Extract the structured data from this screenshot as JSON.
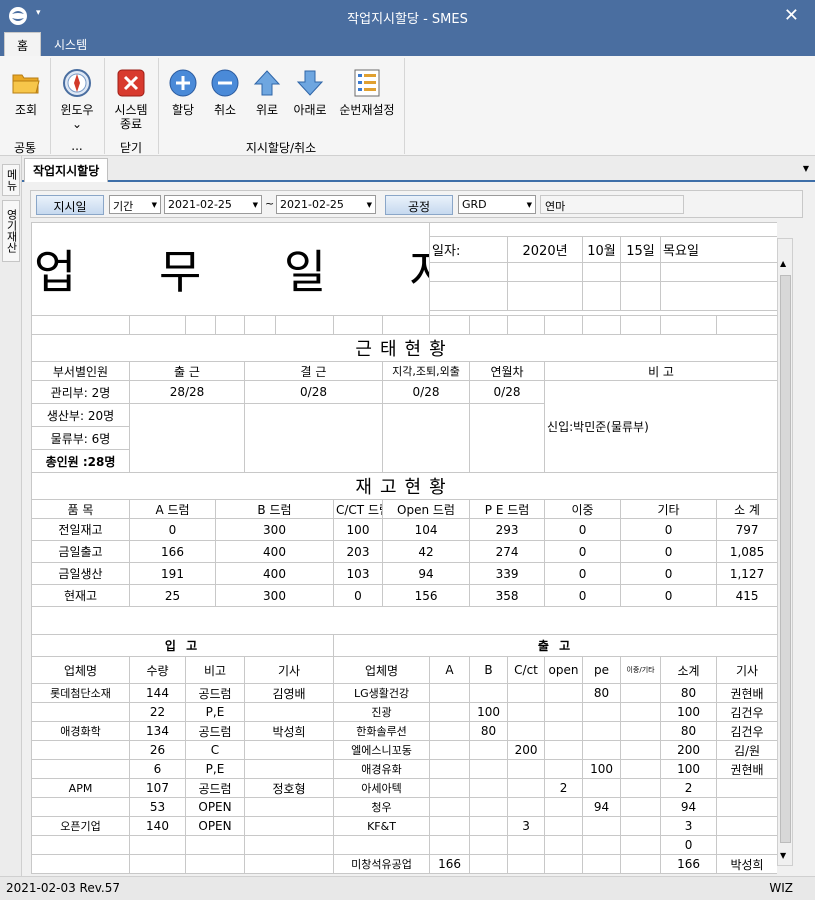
{
  "window": {
    "title": "작업지시할당 - SMES",
    "quick_access": "▾",
    "close": "✕"
  },
  "ribbon_tabs": [
    "홈",
    "시스템"
  ],
  "ribbon": {
    "buttons": [
      "조회",
      "윈도우",
      "시스템",
      "종료",
      "할당",
      "취소",
      "위로",
      "아래로",
      "순번재설정"
    ],
    "dropdown_mark": "⌄",
    "groups": [
      "공통",
      "...",
      "닫기",
      "지시할당/취소"
    ]
  },
  "side_tabs": [
    "메뉴",
    "영기재산"
  ],
  "doc_tab": "작업지시할당",
  "filter": {
    "btn_date": "지시일",
    "period": "기간",
    "date_from": "2021-02-25",
    "tilde": "~",
    "date_to": "2021-02-25",
    "btn_process": "공정",
    "process": "GRD",
    "process_name": "연마"
  },
  "report": {
    "title": "업 무 일 지",
    "date_label": "일자:",
    "date_year": "2020년",
    "date_month": "10월",
    "date_day": "15일",
    "weekday": "목요일",
    "attendance": {
      "section": "근태현황",
      "headers": [
        "부서별인원",
        "출 근",
        "결 근",
        "지각,조퇴,외출",
        "연월차",
        "비    고"
      ],
      "row1": [
        "관리부: 2명",
        "28/28",
        "0/28",
        "0/28",
        "0/28"
      ],
      "rows": [
        "생산부: 20명",
        "물류부: 6명",
        "총인원 :28명"
      ],
      "remark": "신입:박민준(물류부)"
    },
    "inventory": {
      "section": "재고현황",
      "headers": [
        "품 목",
        "A 드럼",
        "B 드럼",
        "C/CT 드럼",
        "Open 드럼",
        "P E 드럼",
        "이중",
        "기타",
        "소 계"
      ],
      "rows": [
        [
          "전일재고",
          "0",
          "300",
          "100",
          "104",
          "293",
          "0",
          "0",
          "797"
        ],
        [
          "금일출고",
          "166",
          "400",
          "203",
          "42",
          "274",
          "0",
          "0",
          "1,085"
        ],
        [
          "금일생산",
          "191",
          "400",
          "103",
          "94",
          "339",
          "0",
          "0",
          "1,127"
        ],
        [
          "현재고",
          "25",
          "300",
          "0",
          "156",
          "358",
          "0",
          "0",
          "415"
        ]
      ]
    },
    "io": {
      "in_title": "입 고",
      "out_title": "출 고",
      "headers": [
        "업체명",
        "수량",
        "비고",
        "기사",
        "업체명",
        "A",
        "B",
        "C/ct",
        "open",
        "pe",
        "이중/기타",
        "소계",
        "기사"
      ],
      "rows": [
        [
          "롯데첨단소재",
          "144",
          "공드럼",
          "김영배",
          "LG생활건강",
          "",
          "",
          "",
          "",
          "80",
          "",
          "80",
          "권현배"
        ],
        [
          "",
          "22",
          "P,E",
          "",
          "진광",
          "",
          "100",
          "",
          "",
          "",
          "",
          "100",
          "김건우"
        ],
        [
          "애경화학",
          "134",
          "공드럼",
          "박성희",
          "한화솔루션",
          "",
          "80",
          "",
          "",
          "",
          "",
          "80",
          "김건우"
        ],
        [
          "",
          "26",
          "C",
          "",
          "엘에스니꼬동",
          "",
          "",
          "200",
          "",
          "",
          "",
          "200",
          "김/원"
        ],
        [
          "",
          "6",
          "P,E",
          "",
          "애경유화",
          "",
          "",
          "",
          "",
          "100",
          "",
          "100",
          "권현배"
        ],
        [
          "APM",
          "107",
          "공드럼",
          "정호형",
          "아세아텍",
          "",
          "",
          "",
          "2",
          "",
          "",
          "2",
          ""
        ],
        [
          "",
          "53",
          "OPEN",
          "",
          "청우",
          "",
          "",
          "",
          "",
          "94",
          "",
          "94",
          ""
        ],
        [
          "오픈기업",
          "140",
          "OPEN",
          "",
          "KF&T",
          "",
          "",
          "3",
          "",
          "",
          "",
          "3",
          ""
        ],
        [
          "",
          "",
          "",
          "",
          "",
          "",
          "",
          "",
          "",
          "",
          "",
          "0",
          ""
        ],
        [
          "",
          "",
          "",
          "",
          "미창석유공업",
          "166",
          "",
          "",
          "",
          "",
          "",
          "166",
          "박성희"
        ]
      ]
    }
  },
  "status": {
    "left": "2021-02-03 Rev.57",
    "right": "WIZ"
  }
}
